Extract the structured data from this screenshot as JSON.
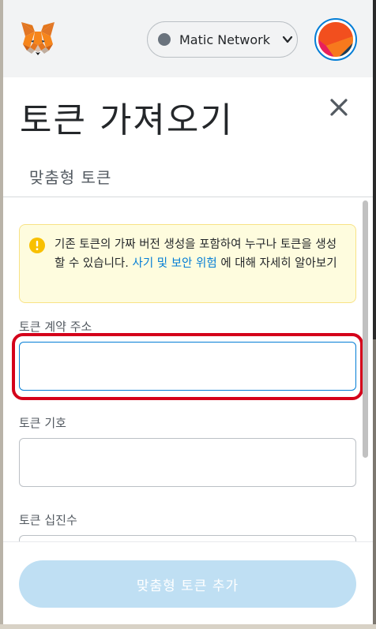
{
  "header": {
    "network_name": "Matic Network"
  },
  "page": {
    "title": "토큰 가져오기",
    "tab_label": "맞춤형 토큰"
  },
  "warning": {
    "text_before": "기존 토큰의 가짜 버전 생성을 포함하여 누구나 토큰을 생성할 수 있습니다. ",
    "link_text": "사기 및 보안 위험",
    "text_after": "에 대해 자세히 알아보기"
  },
  "form": {
    "contract_address": {
      "label": "토큰 계약 주소",
      "value": ""
    },
    "symbol": {
      "label": "토큰 기호",
      "value": ""
    },
    "decimals": {
      "label": "토큰 십진수",
      "value": ""
    }
  },
  "footer": {
    "add_button_label": "맞춤형 토큰 추가"
  },
  "colors": {
    "accent": "#037dd6",
    "highlight": "#d4001a",
    "button_disabled": "#bfdff3",
    "warning_bg": "#fefcde"
  }
}
